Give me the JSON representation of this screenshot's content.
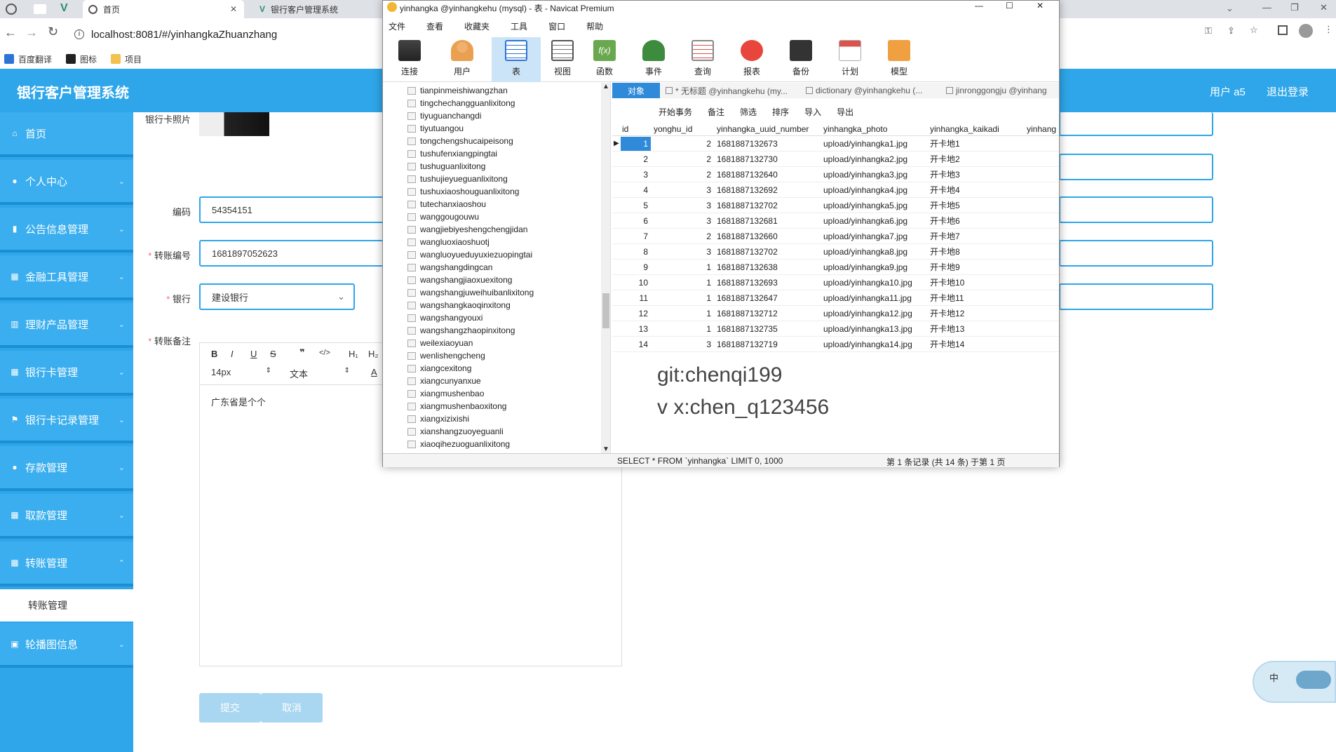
{
  "browser": {
    "tabs": [
      {
        "label": "首页"
      },
      {
        "label": "银行客户管理系统"
      }
    ],
    "url": "localhost:8081/#/yinhangkaZhuanzhang",
    "bookmarks": [
      "百度翻译",
      "图标",
      "项目"
    ]
  },
  "app": {
    "title": "银行客户管理系统",
    "user": "用户 a5",
    "logout": "退出登录"
  },
  "sidebar": {
    "items": [
      {
        "label": "首页"
      },
      {
        "label": "个人中心"
      },
      {
        "label": "公告信息管理"
      },
      {
        "label": "金融工具管理"
      },
      {
        "label": "理财产品管理"
      },
      {
        "label": "银行卡管理"
      },
      {
        "label": "银行卡记录管理"
      },
      {
        "label": "存款管理"
      },
      {
        "label": "取款管理"
      },
      {
        "label": "转账管理"
      }
    ],
    "sub_item": "转账管理",
    "last_item": "轮播图信息"
  },
  "form": {
    "photo_label": "银行卡照片",
    "code_label": "编码",
    "code_value": "54354151",
    "transfer_no_label": "转账编号",
    "transfer_no_value": "1681897052623",
    "bank_label": "银行",
    "bank_value": "建设银行",
    "note_label": "转账备注",
    "font_size": "14px",
    "text_style": "文本",
    "note_content": "广东省是个个",
    "submit": "提交",
    "cancel": "取消"
  },
  "navicat": {
    "title": "yinhangka @yinhangkehu (mysql) - 表 - Navicat Premium",
    "menu": [
      "文件",
      "查看",
      "收藏夹",
      "工具",
      "窗口",
      "帮助"
    ],
    "toolbar": [
      "连接",
      "用户",
      "表",
      "视图",
      "函数",
      "事件",
      "查询",
      "报表",
      "备份",
      "计划",
      "模型"
    ],
    "tree": [
      "tianpinmeishiwangzhan",
      "tingchechangguanlixitong",
      "tiyuguanchangdi",
      "tiyutuangou",
      "tongchengshucaipeisong",
      "tushufenxiangpingtai",
      "tushuguanlixitong",
      "tushujieyueguanlixitong",
      "tushuxiaoshouguanlixitong",
      "tutechanxiaoshou",
      "wanggougouwu",
      "wangjiebiyeshengchengjidan",
      "wangluoxiaoshuotj",
      "wangluoyueduyuxiezuopingtai",
      "wangshangdingcan",
      "wangshangjiaoxuexitong",
      "wangshangjuweihuibanlixitong",
      "wangshangkaoqinxitong",
      "wangshangyouxi",
      "wangshangzhaopinxitong",
      "weilexiaoyuan",
      "wenlishengcheng",
      "xiangcexitong",
      "xiangcunyanxue",
      "xiangmushenbao",
      "xiangmushenbaoxitong",
      "xiangxizixishi",
      "xianshangzuoyeguanli",
      "xiaoqihezuoguanlixitong"
    ],
    "tabs": [
      "对象",
      "* 无标题 @yinhangkehu (my...",
      "dictionary @yinhangkehu (...",
      "jinronggongju @yinhang"
    ],
    "actions": [
      "开始事务",
      "备注",
      "筛选",
      "排序",
      "导入",
      "导出"
    ],
    "columns": [
      "id",
      "yonghu_id",
      "yinhangka_uuid_number",
      "yinhangka_photo",
      "yinhangka_kaikadi",
      "yinhang"
    ],
    "rows": [
      [
        "1",
        "2",
        "1681887132673",
        "upload/yinhangka1.jpg",
        "开卡地1"
      ],
      [
        "2",
        "2",
        "1681887132730",
        "upload/yinhangka2.jpg",
        "开卡地2"
      ],
      [
        "3",
        "2",
        "1681887132640",
        "upload/yinhangka3.jpg",
        "开卡地3"
      ],
      [
        "4",
        "3",
        "1681887132692",
        "upload/yinhangka4.jpg",
        "开卡地4"
      ],
      [
        "5",
        "3",
        "1681887132702",
        "upload/yinhangka5.jpg",
        "开卡地5"
      ],
      [
        "6",
        "3",
        "1681887132681",
        "upload/yinhangka6.jpg",
        "开卡地6"
      ],
      [
        "7",
        "2",
        "1681887132660",
        "upload/yinhangka7.jpg",
        "开卡地7"
      ],
      [
        "8",
        "3",
        "1681887132702",
        "upload/yinhangka8.jpg",
        "开卡地8"
      ],
      [
        "9",
        "1",
        "1681887132638",
        "upload/yinhangka9.jpg",
        "开卡地9"
      ],
      [
        "10",
        "1",
        "1681887132693",
        "upload/yinhangka10.jpg",
        "开卡地10"
      ],
      [
        "11",
        "1",
        "1681887132647",
        "upload/yinhangka11.jpg",
        "开卡地11"
      ],
      [
        "12",
        "1",
        "1681887132712",
        "upload/yinhangka12.jpg",
        "开卡地12"
      ],
      [
        "13",
        "1",
        "1681887132735",
        "upload/yinhangka13.jpg",
        "开卡地13"
      ],
      [
        "14",
        "3",
        "1681887132719",
        "upload/yinhangka14.jpg",
        "开卡地14"
      ]
    ],
    "watermark1": "git:chenqi199",
    "watermark2": "v x:chen_q123456",
    "sql": "SELECT * FROM `yinhangka` LIMIT 0, 1000",
    "records": "第 1 条记录 (共 14 条) 于第 1 页"
  },
  "ime": "中",
  "colors": {
    "accent": "#2ea6e9",
    "navicat_select": "#2f8ad9",
    "record_dot": "#e8453c"
  }
}
